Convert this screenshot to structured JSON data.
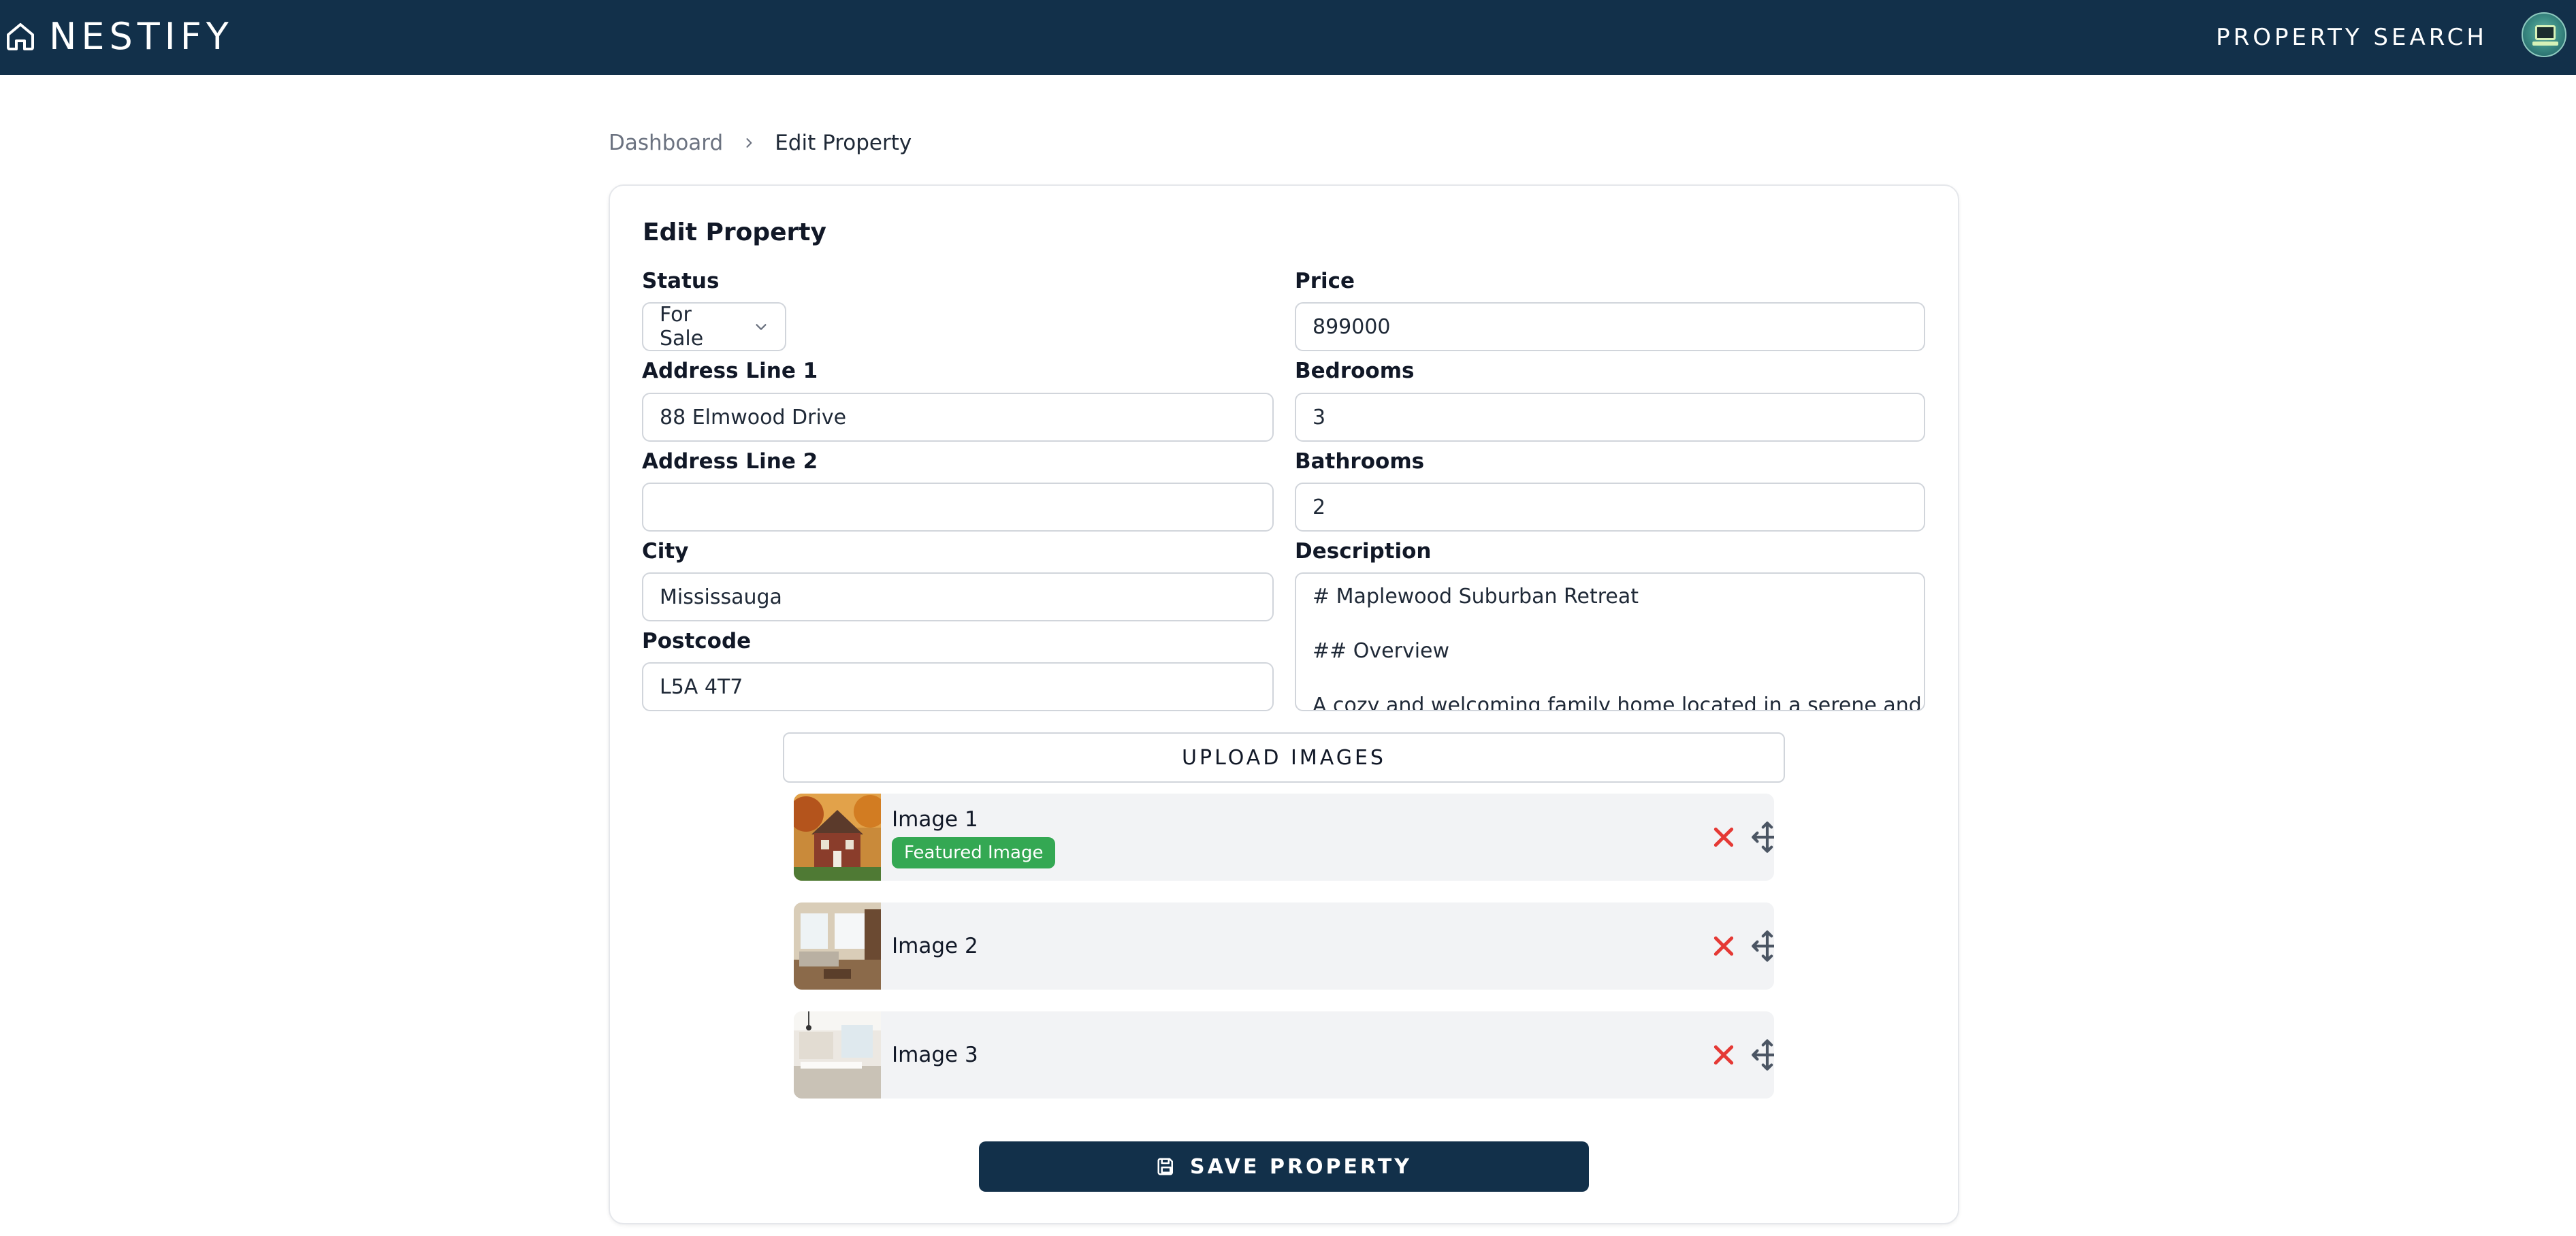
{
  "header": {
    "brand": "NESTIFY",
    "nav_link": "PROPERTY SEARCH"
  },
  "breadcrumb": {
    "items": [
      "Dashboard",
      "Edit Property"
    ]
  },
  "form": {
    "title": "Edit Property",
    "status": {
      "label": "Status",
      "value": "For Sale"
    },
    "address1": {
      "label": "Address Line 1",
      "value": "88 Elmwood Drive"
    },
    "address2": {
      "label": "Address Line 2",
      "value": ""
    },
    "city": {
      "label": "City",
      "value": "Mississauga"
    },
    "postcode": {
      "label": "Postcode",
      "value": "L5A 4T7"
    },
    "price": {
      "label": "Price",
      "value": "899000"
    },
    "bedrooms": {
      "label": "Bedrooms",
      "value": "3"
    },
    "bathrooms": {
      "label": "Bathrooms",
      "value": "2"
    },
    "description": {
      "label": "Description",
      "lines": [
        "# Maplewood Suburban Retreat",
        "## Overview",
        "A cozy and welcoming family home located in a serene and"
      ]
    }
  },
  "images": {
    "upload_label": "UPLOAD IMAGES",
    "items": [
      {
        "title": "Image 1",
        "badge": "Featured Image"
      },
      {
        "title": "Image 2"
      },
      {
        "title": "Image 3"
      }
    ]
  },
  "actions": {
    "save_label": "SAVE PROPERTY"
  },
  "colors": {
    "brand": "#12304a",
    "featured_badge": "#34a853",
    "remove_icon": "#e53935",
    "drag_icon": "#4b5563"
  }
}
